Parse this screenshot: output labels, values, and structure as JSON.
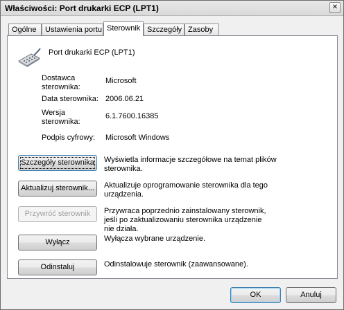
{
  "window": {
    "title": "Właściwości: Port drukarki ECP (LPT1)",
    "close_glyph": "✕"
  },
  "tabs": [
    {
      "label": "Ogólne",
      "active": false
    },
    {
      "label": "Ustawienia portu",
      "active": false
    },
    {
      "label": "Sterownik",
      "active": true
    },
    {
      "label": "Szczegóły",
      "active": false
    },
    {
      "label": "Zasoby",
      "active": false
    }
  ],
  "device": {
    "icon": "printer-port-icon",
    "name": "Port drukarki ECP (LPT1)"
  },
  "info": {
    "provider_label": "Dostawca sterownika:",
    "provider_value": "Microsoft",
    "date_label": "Data sterownika:",
    "date_value": "2006.06.21",
    "version_label": "Wersja sterownika:",
    "version_value": "6.1.7600.16385",
    "signer_label": "Podpis cyfrowy:",
    "signer_value": "Microsoft Windows"
  },
  "actions": {
    "details_label": "Szczegóły sterownika",
    "details_desc": "Wyświetla informacje szczegółowe na temat plików sterownika.",
    "update_label": "Aktualizuj sterownik...",
    "update_desc": "Aktualizuje oprogramowanie sterownika dla tego urządzenia.",
    "rollback_label": "Przywróć sterownik",
    "rollback_desc": "Przywraca poprzednio zainstalowany sterownik, jeśli po zaktualizowaniu sterownika urządzenie nie działa.",
    "disable_label": "Wyłącz",
    "disable_desc": "Wyłącza wybrane urządzenie.",
    "uninstall_label": "Odinstaluj",
    "uninstall_desc": "Odinstalowuje sterownik (zaawansowane)."
  },
  "footer": {
    "ok_label": "OK",
    "cancel_label": "Anuluj"
  }
}
